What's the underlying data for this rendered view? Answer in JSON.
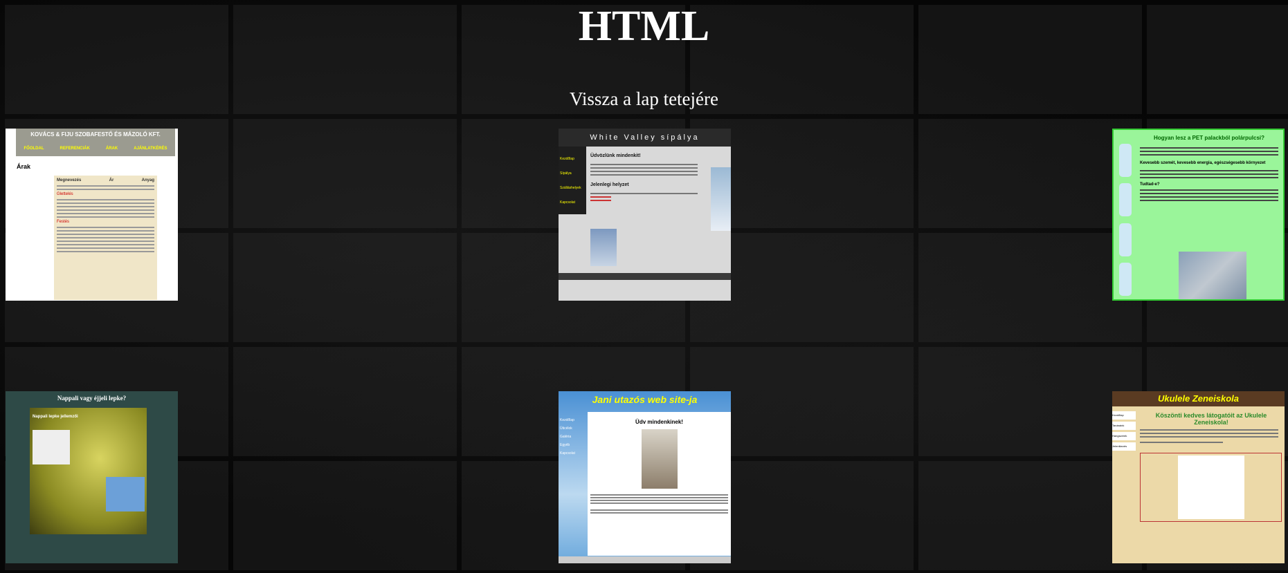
{
  "page": {
    "title": "HTML",
    "back_link": "Vissza a lap tetejére"
  },
  "thumb1": {
    "header": "KOVÁCS & FIJU SZOBAFESTŐ ÉS MÁZOLÓ KFT.",
    "nav": [
      "FŐOLDAL",
      "REFERENCIÁK",
      "ÁRAK",
      "AJÁNLATKÉRÉS"
    ],
    "heading": "Árak",
    "table_cols": [
      "Megnevezés",
      "Ár",
      "Anyag"
    ],
    "section_a": "Glettelés",
    "section_b": "Festés"
  },
  "thumb2": {
    "title": "White Valley sípálya",
    "nav": [
      "Kezdőlap",
      "Sípálya",
      "Szálláshelyek",
      "Kapcsolat"
    ],
    "heading": "Üdvözlünk mindenkit!",
    "subheading": "Jelenlegi helyzet"
  },
  "thumb3": {
    "title": "Hogyan lesz a PET palackból polárpulcsi?",
    "subheading": "Kevesebb szemét, kevesebb energia, egészségesebb környezet",
    "list_title": "Tudtad-e?"
  },
  "thumb4": {
    "title": "Nappali vagy éjjeli lepke?",
    "subtitle": "Nappali lepke jellemzői"
  },
  "thumb5": {
    "title": "Jani utazós web site-ja",
    "greeting": "Üdv mindenkinek!",
    "nav": [
      "Kezdőlap",
      "Úticélok",
      "Galéria",
      "Egyéb",
      "Kapcsolat"
    ]
  },
  "thumb6": {
    "title": "Ukulele Zeneiskola",
    "welcome": "Köszönti kedves látogatóit az Ukulele Zeneiskola!",
    "nav": [
      "Kezdőlap",
      "Tanáraink",
      "Hangszerek",
      "Jelentkezés"
    ]
  },
  "colors": {
    "background": "#141414",
    "mortar": "#060606",
    "text": "#ffffff"
  }
}
